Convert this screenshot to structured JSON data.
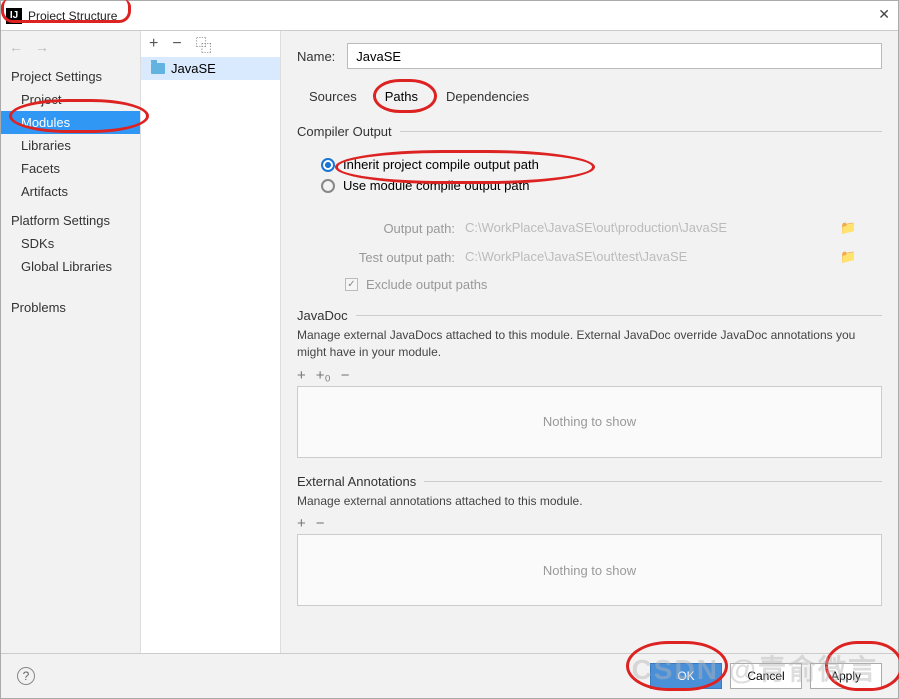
{
  "window": {
    "title": "Project Structure"
  },
  "sidebar": {
    "heading_project": "Project Settings",
    "items_project": [
      "Project",
      "Modules",
      "Libraries",
      "Facets",
      "Artifacts"
    ],
    "selected_project_index": 1,
    "heading_platform": "Platform Settings",
    "items_platform": [
      "SDKs",
      "Global Libraries"
    ],
    "problems": "Problems"
  },
  "modules": {
    "list": [
      "JavaSE"
    ]
  },
  "main": {
    "name_label": "Name:",
    "name_value": "JavaSE",
    "tabs": [
      "Sources",
      "Paths",
      "Dependencies"
    ],
    "active_tab_index": 1,
    "compiler_output": {
      "legend": "Compiler Output",
      "inherit_label": "Inherit project compile output path",
      "module_label": "Use module compile output path",
      "selected": "inherit",
      "output_label": "Output path:",
      "output_value": "C:\\WorkPlace\\JavaSE\\out\\production\\JavaSE",
      "test_output_label": "Test output path:",
      "test_output_value": "C:\\WorkPlace\\JavaSE\\out\\test\\JavaSE",
      "exclude_label": "Exclude output paths",
      "exclude_checked": true
    },
    "javadoc": {
      "legend": "JavaDoc",
      "desc": "Manage external JavaDocs attached to this module. External JavaDoc override JavaDoc annotations you might have in your module.",
      "empty": "Nothing to show"
    },
    "ext_anno": {
      "legend": "External Annotations",
      "desc": "Manage external annotations attached to this module.",
      "empty": "Nothing to show"
    }
  },
  "buttons": {
    "ok": "OK",
    "cancel": "Cancel",
    "apply": "Apply"
  }
}
